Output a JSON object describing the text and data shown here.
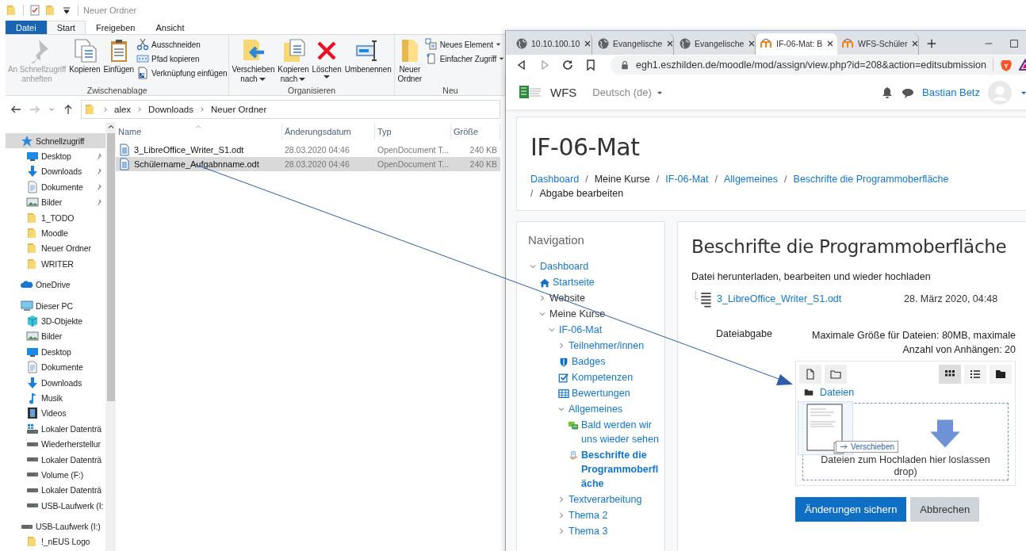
{
  "explorer": {
    "title": "Neuer Ordner",
    "ribbon_tabs": [
      {
        "label": "Datei",
        "kind": "file",
        "selected": false
      },
      {
        "label": "Start",
        "kind": "tab",
        "selected": true
      },
      {
        "label": "Freigeben",
        "kind": "tab",
        "selected": false
      },
      {
        "label": "Ansicht",
        "kind": "tab",
        "selected": false
      }
    ],
    "ribbon_groups": [
      {
        "label": "Zwischenablage",
        "items": [
          {
            "kind": "pin",
            "lines": [
              "An Schnellzugriff",
              "anheften"
            ],
            "disabled": true,
            "dropdown": false
          },
          {
            "kind": "copy",
            "lines": [
              "Kopieren"
            ],
            "disabled": false,
            "dropdown": false
          },
          {
            "kind": "paste",
            "lines": [
              "Einfügen"
            ],
            "disabled": false,
            "dropdown": false
          },
          {
            "kind": "stack",
            "items": [
              {
                "kind": "cut",
                "label": "Ausschneiden",
                "dropdown": false
              },
              {
                "kind": "path",
                "label": "Pfad kopieren",
                "dropdown": false
              },
              {
                "kind": "shortcut",
                "label": "Verknüpfung einfügen",
                "dropdown": false
              }
            ]
          }
        ]
      },
      {
        "label": "Organisieren",
        "items": [
          {
            "kind": "move",
            "lines": [
              "Verschieben",
              "nach"
            ],
            "disabled": false,
            "dropdown": true
          },
          {
            "kind": "copyto",
            "lines": [
              "Kopieren",
              "nach"
            ],
            "disabled": false,
            "dropdown": true
          },
          {
            "kind": "delete",
            "lines": [
              "Löschen"
            ],
            "disabled": false,
            "dropdown": true
          },
          {
            "kind": "rename",
            "lines": [
              "Umbenennen"
            ],
            "disabled": false,
            "dropdown": false
          }
        ]
      },
      {
        "label": "Neu",
        "items": [
          {
            "kind": "newfolder",
            "lines": [
              "Neuer",
              "Ordner"
            ],
            "disabled": false,
            "dropdown": false
          },
          {
            "kind": "stack",
            "items": [
              {
                "kind": "newitem",
                "label": "Neues Element",
                "dropdown": true
              },
              {
                "kind": "easyaccess",
                "label": "Einfacher Zugriff",
                "dropdown": true
              }
            ]
          }
        ]
      }
    ],
    "address": [
      "alex",
      "Downloads",
      "Neuer Ordner"
    ],
    "nav": [
      {
        "label": "Schnellzugriff",
        "kind": "star",
        "selected": true,
        "children": [
          {
            "label": "Desktop",
            "kind": "desktop",
            "pinned": true,
            "selected": false
          },
          {
            "label": "Downloads",
            "kind": "download",
            "pinned": true,
            "selected": false
          },
          {
            "label": "Dokumente",
            "kind": "document",
            "pinned": true,
            "selected": false
          },
          {
            "label": "Bilder",
            "kind": "picture",
            "pinned": true,
            "selected": false
          },
          {
            "label": "1_TODO",
            "kind": "folder",
            "pinned": false,
            "selected": false
          },
          {
            "label": "Moodle",
            "kind": "folder",
            "pinned": false,
            "selected": false
          },
          {
            "label": "Neuer Ordner",
            "kind": "folder",
            "pinned": false,
            "selected": false
          },
          {
            "label": "WRITER",
            "kind": "folder",
            "pinned": false,
            "selected": false
          }
        ]
      },
      {
        "label": "OneDrive",
        "kind": "cloud",
        "selected": false
      },
      {
        "label": "Dieser PC",
        "kind": "pc",
        "selected": false,
        "children": [
          {
            "label": "3D-Objekte",
            "kind": "cube",
            "selected": false
          },
          {
            "label": "Bilder",
            "kind": "picture",
            "selected": false
          },
          {
            "label": "Desktop",
            "kind": "desktop",
            "selected": false
          },
          {
            "label": "Dokumente",
            "kind": "document",
            "selected": false
          },
          {
            "label": "Downloads",
            "kind": "download",
            "selected": false
          },
          {
            "label": "Musik",
            "kind": "music",
            "selected": false
          },
          {
            "label": "Videos",
            "kind": "video",
            "selected": false
          },
          {
            "label": "Lokaler Datenträ",
            "kind": "windrive",
            "selected": false
          },
          {
            "label": "Wiederherstellur",
            "kind": "drive",
            "selected": false
          },
          {
            "label": "Lokaler Datenträ",
            "kind": "drive",
            "selected": false
          },
          {
            "label": "Volume (F:)",
            "kind": "drive",
            "selected": false
          },
          {
            "label": "Lokaler Datenträ",
            "kind": "drive",
            "selected": false
          },
          {
            "label": "USB-Laufwerk (I:",
            "kind": "drive",
            "selected": false
          }
        ]
      },
      {
        "label": "USB-Laufwerk (I:)",
        "kind": "drive",
        "selected": false,
        "children": [
          {
            "label": "!_nEUS Logo",
            "kind": "folder",
            "selected": false
          }
        ]
      }
    ],
    "files": {
      "columns": [
        "Name",
        "Änderungsdatum",
        "Typ",
        "Größe"
      ],
      "rows": [
        {
          "cells": [
            "3_LibreOffice_Writer_S1.odt",
            "28.03.2020 04:46",
            "OpenDocument T...",
            "240 KB"
          ],
          "selected": false
        },
        {
          "cells": [
            "Schülername_Aufgabnname.odt",
            "28.03.2020 04:46",
            "OpenDocument T...",
            "240 KB"
          ],
          "selected": true
        }
      ]
    }
  },
  "browser": {
    "tabs": [
      {
        "label": "10.10.100.10",
        "kind": "globe",
        "selected": false
      },
      {
        "label": "Evangelische",
        "kind": "globe",
        "selected": false
      },
      {
        "label": "Evangelische",
        "kind": "globe",
        "selected": false
      },
      {
        "label": "IF-06-Mat: B",
        "kind": "moodle",
        "selected": true
      },
      {
        "label": "WFS-Schüler",
        "kind": "moodle",
        "selected": false
      }
    ],
    "url": "egh1.eszhilden.de/moodle/mod/assign/view.php?id=208&action=editsubmission",
    "site": {
      "name": "WFS",
      "language": "Deutsch (de)",
      "user": "Bastian Betz"
    },
    "page": {
      "title": "IF-06-Mat",
      "breadcrumb": {
        "separator": "/",
        "items": [
          {
            "label": "Dashboard",
            "link": true
          },
          {
            "label": "Meine Kurse",
            "link": false
          },
          {
            "label": "IF-06-Mat",
            "link": true
          },
          {
            "label": "Allgemeines",
            "link": true
          },
          {
            "label": "Beschrifte die Programmoberfläche",
            "link": true
          },
          {
            "label": "Abgabe bearbeiten",
            "link": false
          }
        ]
      },
      "navigation": {
        "title": "Navigation",
        "items": [
          {
            "label": "Dashboard",
            "kind": "branch",
            "expanded": true,
            "link": true,
            "current": false,
            "children": [
              {
                "label": "Startseite",
                "kind": "home",
                "link": true,
                "current": false
              },
              {
                "label": "Website",
                "kind": "branch",
                "expanded": false,
                "link": false,
                "current": false
              },
              {
                "label": "Meine Kurse",
                "kind": "branch",
                "expanded": true,
                "link": false,
                "current": false,
                "children": [
                  {
                    "label": "IF-06-Mat",
                    "kind": "branch",
                    "expanded": true,
                    "link": true,
                    "current": false,
                    "children": [
                      {
                        "label": "Teilnehmer/innen",
                        "kind": "branch",
                        "expanded": false,
                        "link": true,
                        "current": false
                      },
                      {
                        "label": "Badges",
                        "kind": "badge",
                        "link": true,
                        "current": false
                      },
                      {
                        "label": "Kompetenzen",
                        "kind": "competency",
                        "link": true,
                        "current": false
                      },
                      {
                        "label": "Bewertungen",
                        "kind": "grades",
                        "link": true,
                        "current": false
                      },
                      {
                        "label": "Allgemeines",
                        "kind": "branch",
                        "expanded": true,
                        "link": true,
                        "current": false,
                        "children": [
                          {
                            "label": "Bald werden wir uns wieder sehen",
                            "kind": "forum",
                            "link": true,
                            "current": false
                          },
                          {
                            "label": "Beschrifte die Programmoberfläche",
                            "kind": "assignment",
                            "link": true,
                            "current": true
                          }
                        ]
                      },
                      {
                        "label": "Textverarbeitung",
                        "kind": "branch",
                        "expanded": false,
                        "link": true,
                        "current": false
                      },
                      {
                        "label": "Thema 2",
                        "kind": "branch",
                        "expanded": false,
                        "link": true,
                        "current": false
                      },
                      {
                        "label": "Thema 3",
                        "kind": "branch",
                        "expanded": false,
                        "link": true,
                        "current": false
                      }
                    ]
                  }
                ]
              }
            ]
          }
        ]
      },
      "assignment": {
        "title": "Beschrifte die Programmoberfläche",
        "intro": "Datei herunterladen, bearbeiten und wieder hochladen",
        "attachment": {
          "name": "3_LibreOffice_Writer_S1.odt",
          "date": "28. März 2020, 04:48"
        },
        "field_label": "Dateiabgabe",
        "limits": "Maximale Größe für Dateien: 80MB, maximale Anzahl von Anhängen: 20",
        "views": [
          {
            "kind": "icons",
            "selected": true
          },
          {
            "kind": "list",
            "selected": false
          },
          {
            "kind": "tree",
            "selected": false
          }
        ],
        "folder": "Dateien",
        "drop_text": "Dateien zum Hochladen hier loslassen",
        "drop_text_2": "drop)",
        "drag_label": "Verschieben",
        "buttons": [
          {
            "label": "Änderungen sichern",
            "kind": "primary"
          },
          {
            "label": "Abbrechen",
            "kind": "secondary"
          }
        ]
      }
    }
  }
}
